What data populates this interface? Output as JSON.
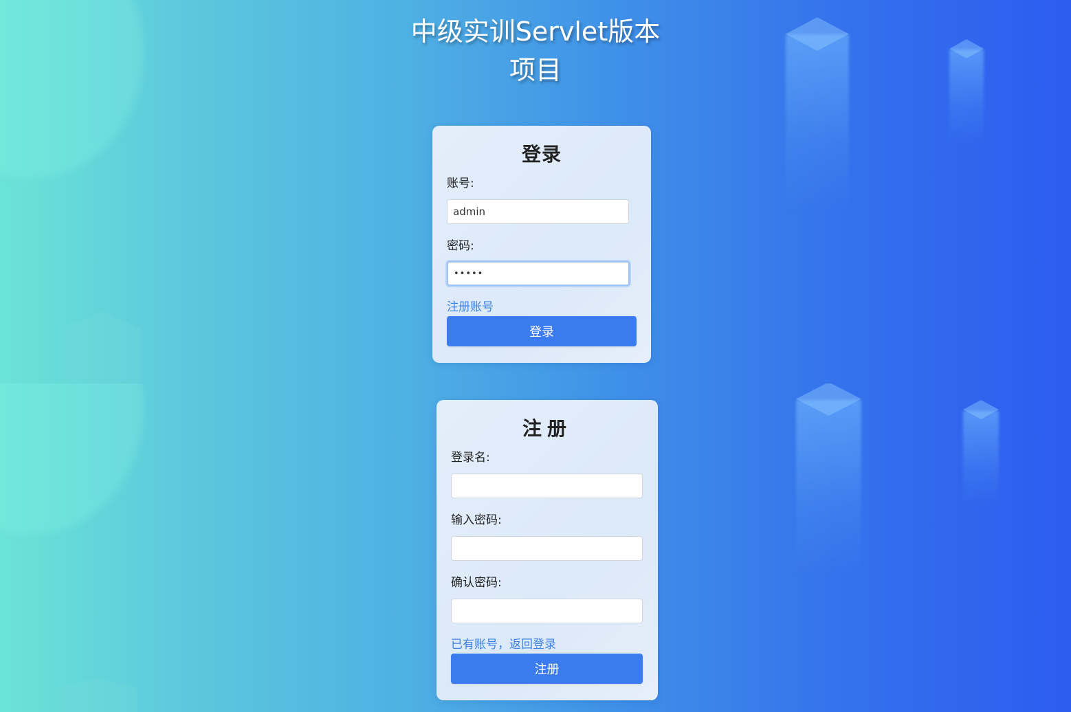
{
  "app": {
    "title_line1": "中级实训Servlet版本",
    "title_line2": "项目"
  },
  "login": {
    "title": "登录",
    "account_label": "账号:",
    "account_value": "admin",
    "password_label": "密码:",
    "password_value": "•••••",
    "register_link": "注册账号",
    "submit_label": "登录"
  },
  "register": {
    "title": "注册",
    "username_label": "登录名:",
    "username_value": "",
    "password_label": "输入密码:",
    "password_value": "",
    "confirm_label": "确认密码:",
    "confirm_value": "",
    "login_link": "已有账号，返回登录",
    "submit_label": "注册"
  },
  "theme": {
    "button_color": "#3a7bf0",
    "link_color": "#3d82e4",
    "background_left": "#6ae3d7",
    "background_right": "#2c5cf0"
  }
}
